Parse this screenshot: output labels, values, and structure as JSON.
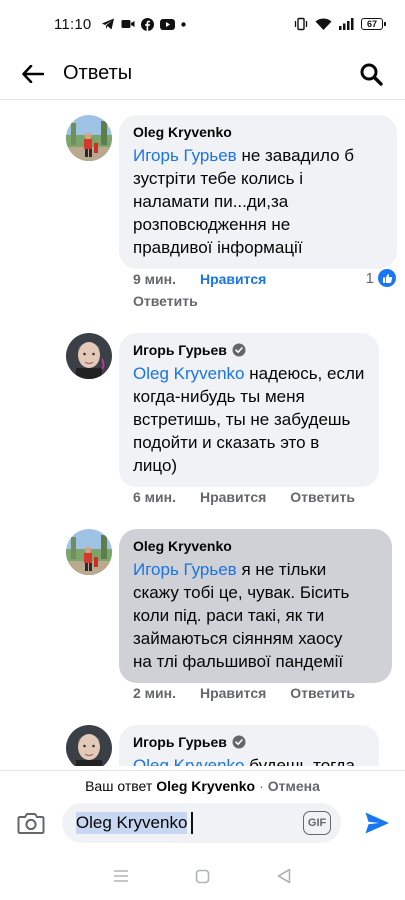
{
  "status_bar": {
    "time": "11:10",
    "battery": "67"
  },
  "header": {
    "title": "Ответы"
  },
  "comments": [
    {
      "author": "Oleg Kryvenko",
      "mention": "Игорь Гурьев",
      "text_lines": [
        " не завадило б",
        "зустріти тебе колись і",
        "наламати пи...ди,за",
        "розповсюдження не",
        "правдивої інформації"
      ],
      "time": "9 мин.",
      "like": "Нравится",
      "reply": "Ответить",
      "reaction_count": "1"
    },
    {
      "author": "Игорь Гурьев",
      "mention": "Oleg Kryvenko",
      "text_lines": [
        " надеюсь, если",
        "когда-нибудь ты меня",
        "встретишь, ты не забудешь",
        "подойти и сказать это в",
        "лицо)"
      ],
      "time": "6 мин.",
      "like": "Нравится",
      "reply": "Ответить"
    },
    {
      "author": "Oleg Kryvenko",
      "mention": "Игорь Гурьев",
      "text_lines": [
        " я не тільки",
        "скажу тобі це, чувак. Бісить",
        "коли під. раси такі, як ти",
        "займаються сіянням хаосу",
        "на тлі фальшивої пандемії"
      ],
      "time": "2 мин.",
      "like": "Нравится",
      "reply": "Ответить"
    },
    {
      "author": "Игорь Гурьев",
      "mention": "Oleg Kryvenko",
      "text_lines": [
        " будешь тогда"
      ]
    }
  ],
  "reply_bar": {
    "prefix": "Ваш ответ",
    "target": "Oleg Kryvenko",
    "separator": "·",
    "cancel": "Отмена"
  },
  "composer": {
    "value": "Oleg Kryvenko",
    "gif": "GIF"
  },
  "icons": [
    "back-arrow-icon",
    "search-icon",
    "verified-icon",
    "like-icon",
    "camera-icon",
    "send-icon"
  ],
  "colors": {
    "link": "#1b74e4",
    "like_badge": "#1877f2",
    "bubble": "#f0f2f5",
    "bubble_selected": "#cfd1d6"
  }
}
